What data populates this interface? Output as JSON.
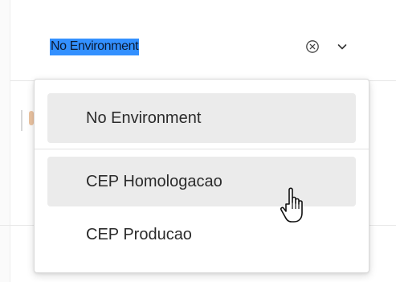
{
  "selector": {
    "value": "No Environment",
    "clear_icon": "circle-x-icon",
    "toggle_icon": "chevron-down-icon"
  },
  "dropdown": {
    "selected_item": "No Environment",
    "items": [
      {
        "label": "CEP Homologacao",
        "hovered": true
      },
      {
        "label": "CEP Producao",
        "hovered": false
      }
    ]
  },
  "cursor": {
    "icon": "hand-pointer-icon"
  },
  "colors": {
    "selection_highlight": "#3390ff",
    "item_hover_bg": "#ebebeb",
    "text": "#2b2b2b"
  }
}
